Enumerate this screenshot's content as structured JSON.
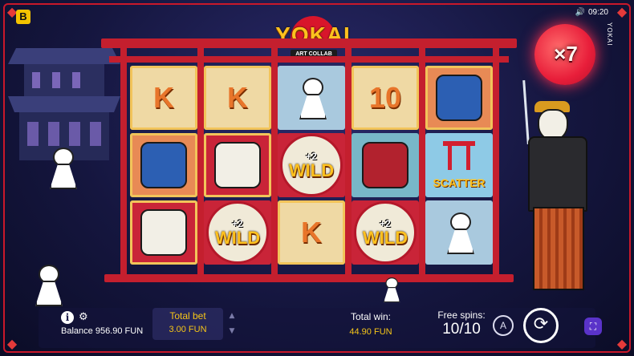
{
  "status": {
    "time": "09:20",
    "sound_icon": "speaker-icon"
  },
  "brand": {
    "badge_letter": "B"
  },
  "game_name_vertical": "YOKAI",
  "logo": {
    "name": "YOKAI",
    "tag": "ART COLLAB"
  },
  "multiplier": "×7",
  "reels": [
    [
      {
        "type": "k",
        "label": "K"
      },
      {
        "type": "mask",
        "label": ""
      },
      {
        "type": "samurai",
        "label": ""
      }
    ],
    [
      {
        "type": "k",
        "label": "K"
      },
      {
        "type": "samurai",
        "label": ""
      },
      {
        "type": "wild",
        "plus": "+2",
        "label": "WILD"
      }
    ],
    [
      {
        "type": "doll",
        "label": ""
      },
      {
        "type": "wild",
        "plus": "+2",
        "label": "WILD"
      },
      {
        "type": "k",
        "label": "K"
      }
    ],
    [
      {
        "type": "ten",
        "label": "10"
      },
      {
        "type": "horse",
        "label": ""
      },
      {
        "type": "wild",
        "plus": "+2",
        "label": "WILD"
      }
    ],
    [
      {
        "type": "mask",
        "label": ""
      },
      {
        "type": "scatter",
        "label": "SCATTER"
      },
      {
        "type": "doll",
        "label": ""
      }
    ]
  ],
  "footer": {
    "info_icon": "info-icon",
    "balance_label": "Balance",
    "balance_value": "956.90 FUN",
    "total_bet_label": "Total bet",
    "total_bet_value": "3.00 FUN",
    "total_win_label": "Total win:",
    "total_win_value": "44.90 FUN",
    "free_spins_label": "Free spins:",
    "free_spins_value": "10/10",
    "auto_label": "A"
  },
  "colors": {
    "accent_red": "#c41f2e",
    "gold": "#f5c518",
    "night_blue": "#15163f"
  }
}
